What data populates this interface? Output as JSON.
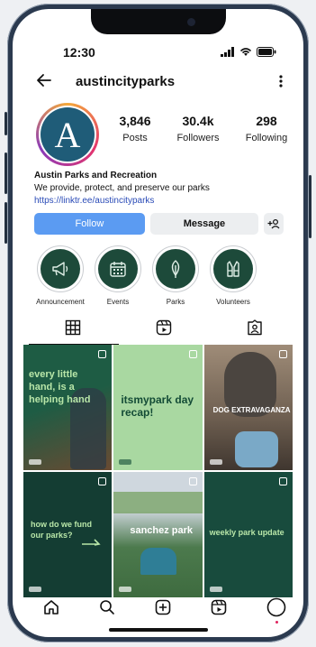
{
  "status": {
    "time": "12:30"
  },
  "profile": {
    "username": "austincityparks",
    "avatar_letter": "A",
    "stats": [
      {
        "value": "3,846",
        "label": "Posts"
      },
      {
        "value": "30.4k",
        "label": "Followers"
      },
      {
        "value": "298",
        "label": "Following"
      }
    ],
    "name": "Austin Parks and Recreation",
    "bio": "We provide, protect, and preserve our parks",
    "link": "https://linktr.ee/austincityparks"
  },
  "actions": {
    "follow": "Follow",
    "message": "Message"
  },
  "highlights": [
    {
      "label": "Announcement",
      "icon": "megaphone-icon"
    },
    {
      "label": "Events",
      "icon": "calendar-icon"
    },
    {
      "label": "Parks",
      "icon": "leaf-icon"
    },
    {
      "label": "Volunteers",
      "icon": "vest-icon"
    }
  ],
  "posts": [
    {
      "text": "every little hand, is a helping hand",
      "bg": "#1e5c44",
      "color": "#b8e6a8"
    },
    {
      "text": "itsmypark day recap!",
      "bg": "#a9d8a1",
      "color": "#134b36"
    },
    {
      "text": "DOG EXTRAVAGANZA",
      "bg": "#7d6b5a",
      "color": "#ffffff"
    },
    {
      "text": "how do we fund our parks?",
      "bg": "#143d33",
      "color": "#b8e6a8"
    },
    {
      "text": "sanchez park",
      "bg": "#5e8a58",
      "color": "#ffffff"
    },
    {
      "text": "weekly park update",
      "bg": "#184b3d",
      "color": "#b8e6a8"
    }
  ],
  "colors": {
    "accent": "#5b9bf2",
    "brand_green": "#1d4a3a"
  }
}
